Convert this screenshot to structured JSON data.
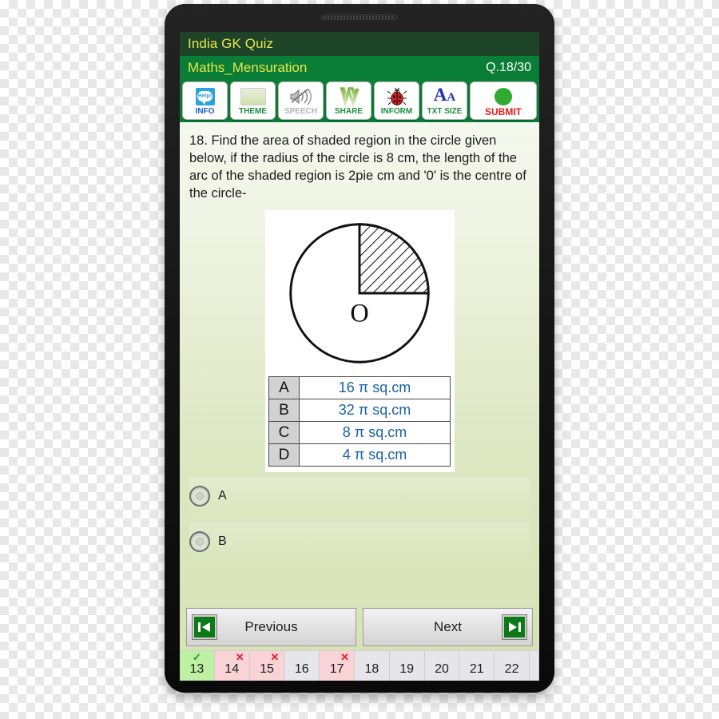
{
  "device": {
    "speaker": "speaker-grille"
  },
  "header": {
    "app_title": "India GK Quiz",
    "topic": "Maths_Mensuration",
    "question_counter": "Q.18/30"
  },
  "toolbar": [
    {
      "name": "info",
      "label": "INFO",
      "icon": "help-bubble-icon",
      "icon_text": "Help!",
      "enabled": true
    },
    {
      "name": "theme",
      "label": "THEME",
      "icon": "theme-swatch-icon",
      "enabled": true
    },
    {
      "name": "speech",
      "label": "SPEECH",
      "icon": "muted-speaker-icon",
      "enabled": false
    },
    {
      "name": "share",
      "label": "SHARE",
      "icon": "whatsapp-share-icon",
      "enabled": true
    },
    {
      "name": "inform",
      "label": "INFORM",
      "icon": "ladybug-icon",
      "enabled": true
    },
    {
      "name": "txt_size",
      "label": "TXT SIZE",
      "icon": "font-size-icon",
      "icon_text": "Aa",
      "enabled": true
    },
    {
      "name": "submit",
      "label": "SUBMIT",
      "icon": "green-circle-icon",
      "enabled": true
    }
  ],
  "question": {
    "number": "18.",
    "text": "18.  Find the area of shaded region in the circle given below, if the radius of the circle is 8 cm, the length of the arc of the shaded region is 2pie cm and '0' is the centre of the circle-",
    "figure": {
      "name": "circle-with-shaded-quadrant",
      "centre_label": "O",
      "shaded_quadrant": "upper-right",
      "radius_cm": 8,
      "arc_length": "2pie cm"
    },
    "options": [
      {
        "key": "A",
        "value": "16 π sq.cm"
      },
      {
        "key": "B",
        "value": "32 π sq.cm"
      },
      {
        "key": "C",
        "value": "8 π sq.cm"
      },
      {
        "key": "D",
        "value": "4 π sq.cm"
      }
    ]
  },
  "answer_choices": [
    {
      "key": "A",
      "selected": false
    },
    {
      "key": "B",
      "selected": false
    }
  ],
  "nav": {
    "previous_label": "Previous",
    "next_label": "Next",
    "previous_icon": "skip-to-start-icon",
    "next_icon": "skip-to-end-icon"
  },
  "question_strip": [
    {
      "num": "13",
      "state": "correct",
      "mark": "✓"
    },
    {
      "num": "14",
      "state": "wrong",
      "mark": "✕"
    },
    {
      "num": "15",
      "state": "wrong",
      "mark": "✕"
    },
    {
      "num": "16",
      "state": "neutral",
      "mark": ""
    },
    {
      "num": "17",
      "state": "wrong",
      "mark": "✕"
    },
    {
      "num": "18",
      "state": "neutral",
      "mark": ""
    },
    {
      "num": "19",
      "state": "neutral",
      "mark": ""
    },
    {
      "num": "20",
      "state": "neutral",
      "mark": ""
    },
    {
      "num": "21",
      "state": "neutral",
      "mark": ""
    },
    {
      "num": "22",
      "state": "neutral",
      "mark": ""
    }
  ],
  "colors": {
    "app_bar": "#1d4427",
    "sub_bar": "#0a7d36",
    "title_text": "#e9e64b",
    "option_value": "#1763ab",
    "submit_label": "#e21a1a",
    "correct": "#bdf0a2",
    "wrong": "#fad3d6",
    "neutral": "#e6e6ea"
  }
}
